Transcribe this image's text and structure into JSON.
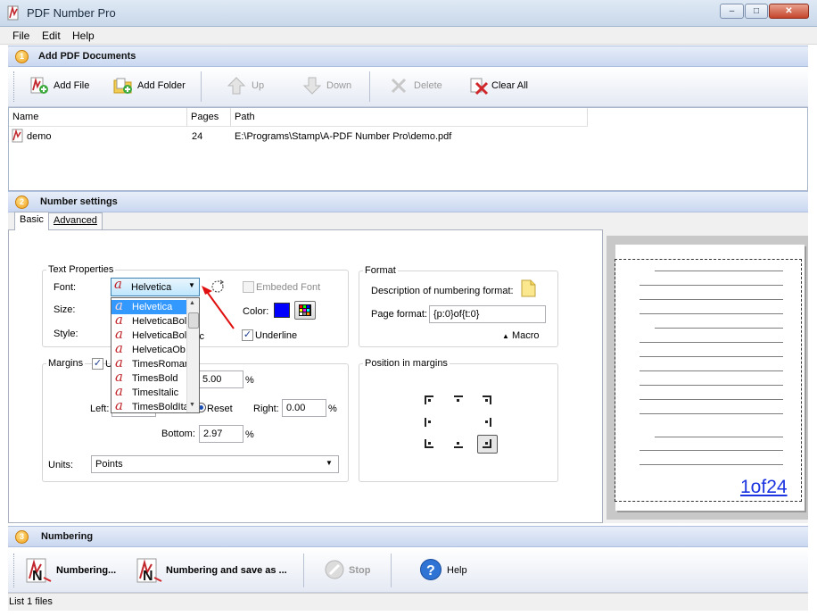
{
  "window": {
    "title": "PDF Number Pro"
  },
  "menu": [
    "File",
    "Edit",
    "Help"
  ],
  "section1": {
    "num": "1",
    "title": "Add PDF Documents"
  },
  "toolbar1": {
    "add_file": "Add File",
    "add_folder": "Add Folder",
    "up": "Up",
    "down": "Down",
    "delete": "Delete",
    "clear_all": "Clear All"
  },
  "filelist": {
    "columns": [
      "Name",
      "Pages",
      "Path"
    ],
    "rows": [
      {
        "name": "demo",
        "pages": "24",
        "path": "E:\\Programs\\Stamp\\A-PDF Number Pro\\demo.pdf"
      }
    ]
  },
  "section2": {
    "num": "2",
    "title": "Number settings"
  },
  "tabs": {
    "basic": "Basic",
    "advanced": "Advanced"
  },
  "text_props": {
    "group": "Text Properties",
    "font_label": "Font:",
    "font_value": "Helvetica",
    "size_label": "Size:",
    "style_label": "Style:",
    "style_partial": "ic",
    "embed_label": "Embeded Font",
    "color_label": "Color:",
    "underline_label": "Underline",
    "color_value": "#0000ff"
  },
  "font_options": [
    "Helvetica",
    "HelveticaBold",
    "HelveticaBoldOblique",
    "HelveticaOblique",
    "TimesRoman",
    "TimesBold",
    "TimesItalic",
    "TimesBoldItalic"
  ],
  "font_options_visible": [
    "Helvetica",
    "HelveticaBol",
    "HelveticaBol",
    "HelveticaOb",
    "TimesRoman",
    "TimesBold",
    "TimesItalic",
    "TimesBoldIta"
  ],
  "format": {
    "group": "Format",
    "desc_label": "Description of numbering format:",
    "page_format_label": "Page format:",
    "page_format_value": "{p:0}of{t:0}",
    "macro": "Macro"
  },
  "margins": {
    "group": "Margins",
    "u_partial": "U",
    "top_value": "5.00",
    "left_label": "Left:",
    "reset": "Reset",
    "right_label": "Right:",
    "right_value": "0.00",
    "bottom_label": "Bottom:",
    "bottom_value": "2.97",
    "pct": "%",
    "units_label": "Units:",
    "units_value": "Points"
  },
  "position": {
    "group": "Position in margins"
  },
  "preview": {
    "number_text": "1of24"
  },
  "section3": {
    "num": "3",
    "title": "Numbering"
  },
  "toolbar3": {
    "numbering": "Numbering...",
    "numbering_save": "Numbering and save as ...",
    "stop": "Stop",
    "help": "Help"
  },
  "status": {
    "text": "List 1 files"
  }
}
